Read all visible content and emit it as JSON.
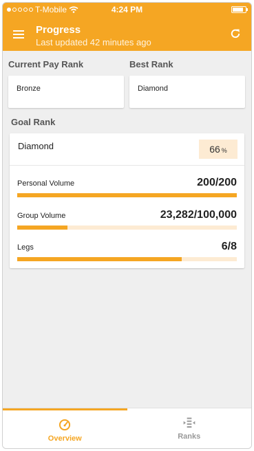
{
  "status_bar": {
    "carrier": "T-Mobile",
    "time": "4:24 PM",
    "battery_level": 0.85
  },
  "appbar": {
    "title": "Progress",
    "subtitle": "Last updated 42 minutes ago"
  },
  "current_pay_rank": {
    "label": "Current Pay Rank",
    "value": "Bronze"
  },
  "best_rank": {
    "label": "Best Rank",
    "value": "Diamond"
  },
  "goal_rank": {
    "label": "Goal Rank",
    "name": "Diamond",
    "percent": "66",
    "percent_unit": "%",
    "metrics": [
      {
        "label": "Personal Volume",
        "value": "200/200",
        "progress": 1.0
      },
      {
        "label": "Group Volume",
        "value": "23,282/100,000",
        "progress": 0.23
      },
      {
        "label": "Legs",
        "value": "6/8",
        "progress": 0.75
      }
    ]
  },
  "tabs": [
    {
      "label": "Overview",
      "icon": "speedometer-icon",
      "active": true
    },
    {
      "label": "Ranks",
      "icon": "ranks-icon",
      "active": false
    }
  ],
  "colors": {
    "accent": "#f5a623",
    "track": "#fdebd3",
    "inactive": "#999999"
  }
}
